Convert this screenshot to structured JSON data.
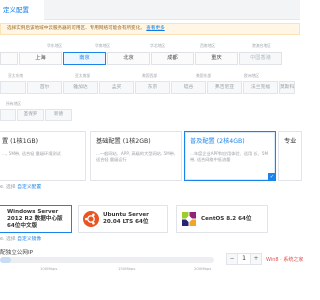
{
  "header": {
    "active_tab": "定义配置"
  },
  "notice": {
    "text": "选择实例后该地域中云服务器的可用区、专用网络可能会有所变化。",
    "link": "查看更多"
  },
  "region_groups": [
    {
      "label": "华东地区"
    },
    {
      "label": "华南地区"
    },
    {
      "label": "华北地区"
    },
    {
      "label": "西南地区"
    },
    {
      "label": "港澳台地区"
    }
  ],
  "regions": [
    {
      "label": "",
      "state": "normal"
    },
    {
      "label": "上海",
      "state": "normal"
    },
    {
      "label": "南京",
      "state": "active"
    },
    {
      "label": "北京",
      "state": "normal"
    },
    {
      "label": "成都",
      "state": "normal"
    },
    {
      "label": "重庆",
      "state": "normal"
    },
    {
      "label": "中国香港",
      "state": "ghost"
    }
  ],
  "zone_groups": [
    {
      "label": "亚太东南"
    },
    {
      "label": "亚太南部"
    },
    {
      "label": "美国西部"
    },
    {
      "label": "美国东部"
    },
    {
      "label": "欧洲地区"
    }
  ],
  "zones": [
    {
      "label": ""
    },
    {
      "label": "首尔"
    },
    {
      "label": "雅加达"
    },
    {
      "label": "孟买"
    },
    {
      "label": "东京"
    },
    {
      "label": "硅谷"
    },
    {
      "label": "弗吉尼亚"
    },
    {
      "label": "法兰克福"
    },
    {
      "label": "莫斯科"
    }
  ],
  "network_label": "所有地区",
  "networks": [
    {
      "label": ""
    },
    {
      "label": "圣保罗"
    },
    {
      "label": "新德"
    }
  ],
  "specs": [
    {
      "title": "置 (1核1GB)",
      "desc": "..., 5M带, 适合轻 量级环境测试",
      "selected": false
    },
    {
      "title": "基础配置 (1核2GB)",
      "desc": "...一般网站、APP, 高级的大型网站, 5M带, 适合轻 量级运行",
      "selected": false
    },
    {
      "title": "普及配置 (2核4GB)",
      "desc": "...年度企业APP和应用体验、适用 长、5M带, 适合网络中低流量",
      "selected": true
    },
    {
      "title": "专业",
      "desc": "",
      "selected": false
    }
  ],
  "spec_footer": {
    "text": "e. 选择",
    "link": "自定义配置"
  },
  "os_options": [
    {
      "name": "Windows Server 2012 R2 数据中心版 64位中文版",
      "icon": "windows-icon",
      "selected": true
    },
    {
      "name": "Ubuntu Server 20.04 LTS 64位",
      "icon": "ubuntu-icon",
      "selected": false
    },
    {
      "name": "CentOS 8.2 64位",
      "icon": "centos-icon",
      "selected": false
    }
  ],
  "os_footer": {
    "text": "e. 选择",
    "link": "自定义镜像"
  },
  "ip": {
    "label": "配独立公网IP",
    "ticks": [
      "100Mbps",
      "150Mbps",
      "200Mbps"
    ],
    "bandwidth_fraction": 0.05,
    "value": "1"
  },
  "watermark": "Win8 · 系统之家"
}
